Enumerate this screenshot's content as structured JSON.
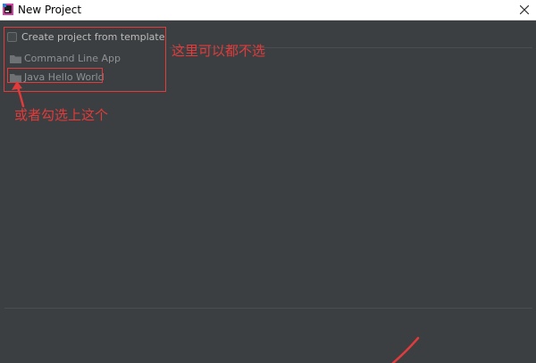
{
  "window": {
    "title": "New Project"
  },
  "template": {
    "checkbox_label": "Create project from template",
    "checked": false
  },
  "templates": [
    {
      "label": "Command Line App"
    },
    {
      "label": "Java Hello World"
    }
  ],
  "annotations": {
    "note_top": "这里可以都不选",
    "note_bottom": "或者勾选上这个",
    "color": "#e23b3b"
  },
  "colors": {
    "background": "#3c3f41",
    "titlebar": "#ffffff",
    "text": "#bbbbbb",
    "annotation": "#e23b3b"
  },
  "icons": {
    "app": "intellij-idea-icon",
    "close": "close-icon",
    "folder": "folder-icon"
  }
}
